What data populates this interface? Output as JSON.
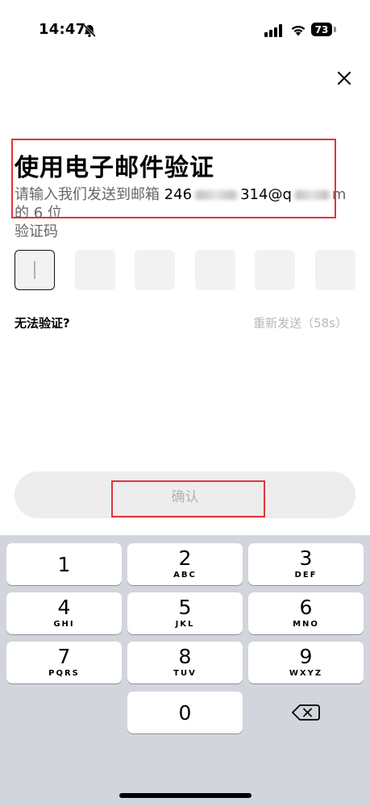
{
  "status_bar": {
    "time": "14:47",
    "battery": "73"
  },
  "header": {
    "title": "使用电子邮件验证",
    "subtitle_prefix": "请输入我们发送到邮箱 ",
    "email_start": "246",
    "email_mid": "314@q",
    "email_end": "m 的 6 位",
    "subtitle_line2": "验证码"
  },
  "code_boxes": [
    "",
    "",
    "",
    "",
    "",
    ""
  ],
  "links": {
    "cannot_verify": "无法验证?",
    "resend": "重新发送（58s）"
  },
  "confirm_label": "确认",
  "keypad": {
    "keys": [
      {
        "digit": "1",
        "letters": ""
      },
      {
        "digit": "2",
        "letters": "ABC"
      },
      {
        "digit": "3",
        "letters": "DEF"
      },
      {
        "digit": "4",
        "letters": "GHI"
      },
      {
        "digit": "5",
        "letters": "JKL"
      },
      {
        "digit": "6",
        "letters": "MNO"
      },
      {
        "digit": "7",
        "letters": "PQRS"
      },
      {
        "digit": "8",
        "letters": "TUV"
      },
      {
        "digit": "9",
        "letters": "WXYZ"
      },
      {
        "digit": "0",
        "letters": ""
      }
    ]
  },
  "colors": {
    "highlight": "#e0353b",
    "keypad_bg": "#d2d5db",
    "disabled_text": "#b4b4b4"
  }
}
